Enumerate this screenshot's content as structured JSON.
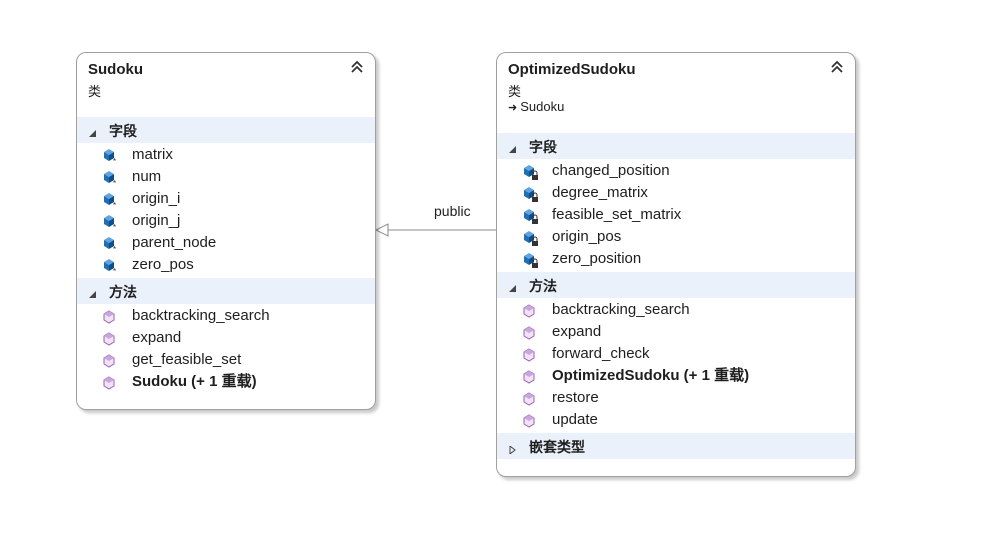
{
  "diagram": {
    "relationship": {
      "label": "public",
      "kind": "inheritance"
    },
    "classes": [
      {
        "name": "Sudoku",
        "kind": "类",
        "collapse_icon": "double-chevron-up-icon",
        "sections": {
          "fields": {
            "label": "字段",
            "expanded": true,
            "icon": "field-icon",
            "items": [
              "matrix",
              "num",
              "origin_i",
              "origin_j",
              "parent_node",
              "zero_pos"
            ]
          },
          "methods": {
            "label": "方法",
            "expanded": true,
            "icon": "method-icon",
            "items": [
              "backtracking_search",
              "expand",
              "get_feasible_set",
              "Sudoku (+ 1 重载)"
            ]
          }
        }
      },
      {
        "name": "OptimizedSudoku",
        "kind": "类",
        "base": "Sudoku",
        "collapse_icon": "double-chevron-up-icon",
        "sections": {
          "fields": {
            "label": "字段",
            "expanded": true,
            "icon": "private-field-icon",
            "items": [
              "changed_position",
              "degree_matrix",
              "feasible_set_matrix",
              "origin_pos",
              "zero_position"
            ]
          },
          "methods": {
            "label": "方法",
            "expanded": true,
            "icon": "method-icon",
            "items": [
              "backtracking_search",
              "expand",
              "forward_check",
              "OptimizedSudoku (+ 1 重载)",
              "restore",
              "update"
            ]
          },
          "nested_types": {
            "label": "嵌套类型",
            "expanded": false
          }
        }
      }
    ]
  },
  "colors": {
    "section_header_bg": "#eaf1fa",
    "field_icon": "#1f6fb5",
    "method_icon": "#9a5fb5",
    "border": "#a0a0a0"
  }
}
